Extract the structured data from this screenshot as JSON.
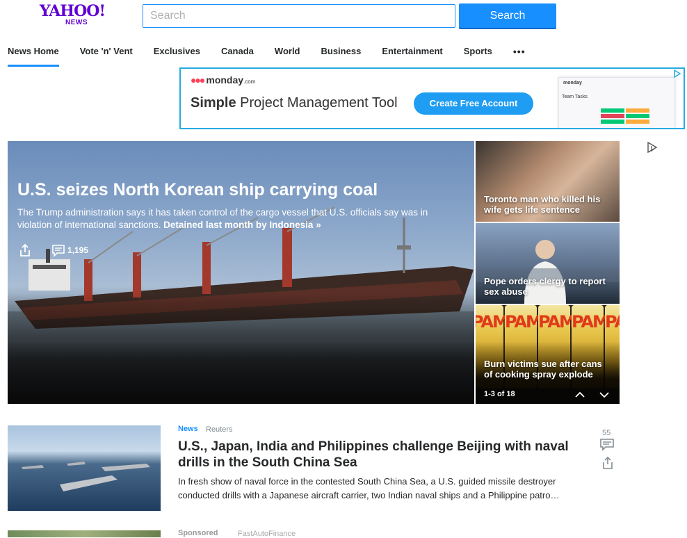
{
  "header": {
    "logo_word": "YAHOO!",
    "logo_sub": "NEWS",
    "search_placeholder": "Search",
    "search_button": "Search"
  },
  "nav": {
    "items": [
      "News Home",
      "Vote 'n' Vent",
      "Exclusives",
      "Canada",
      "World",
      "Business",
      "Entertainment",
      "Sports"
    ],
    "more": "•••",
    "active_index": 0
  },
  "ad": {
    "brand": "monday",
    "brand_suffix": ".com",
    "headline_bold": "Simple",
    "headline_rest": " Project Management Tool",
    "cta": "Create Free Account",
    "mock_brand": "monday",
    "mock_title": "Team Tasks"
  },
  "hero": {
    "title": "U.S. seizes North Korean ship carrying coal",
    "summary": "The Trump administration says it has taken control of the cargo vessel that U.S. officials say was in violation of international sanctions.",
    "link": "Detained last month by Indonesia »",
    "comment_count": "1,195"
  },
  "side_stories": [
    {
      "title": "Toronto man who killed his wife gets life sentence"
    },
    {
      "title": "Pope orders clergy to report sex abuse"
    },
    {
      "title": "Burn victims sue after cans of cooking spray explode"
    }
  ],
  "side_can_labels": [
    "PAM",
    "PAM",
    "PAM",
    "PAM",
    "PAM"
  ],
  "carousel": {
    "count": "1-3 of 18"
  },
  "story": {
    "category": "News",
    "source": "Reuters",
    "title": "U.S., Japan, India and Philippines challenge Beijing with naval drills in the South China Sea",
    "summary": "In fresh show of naval force in the contested South China Sea, a U.S. guided missile destroyer conducted drills with a Japanese aircraft carrier, two Indian naval ships and a Philippine patro…",
    "comment_count": "55"
  },
  "sponsored": {
    "label": "Sponsored",
    "source": "FastAutoFinance"
  },
  "colors": {
    "brand_purple": "#6001d2",
    "accent_blue": "#188fff",
    "ad_border": "#27aae1"
  }
}
